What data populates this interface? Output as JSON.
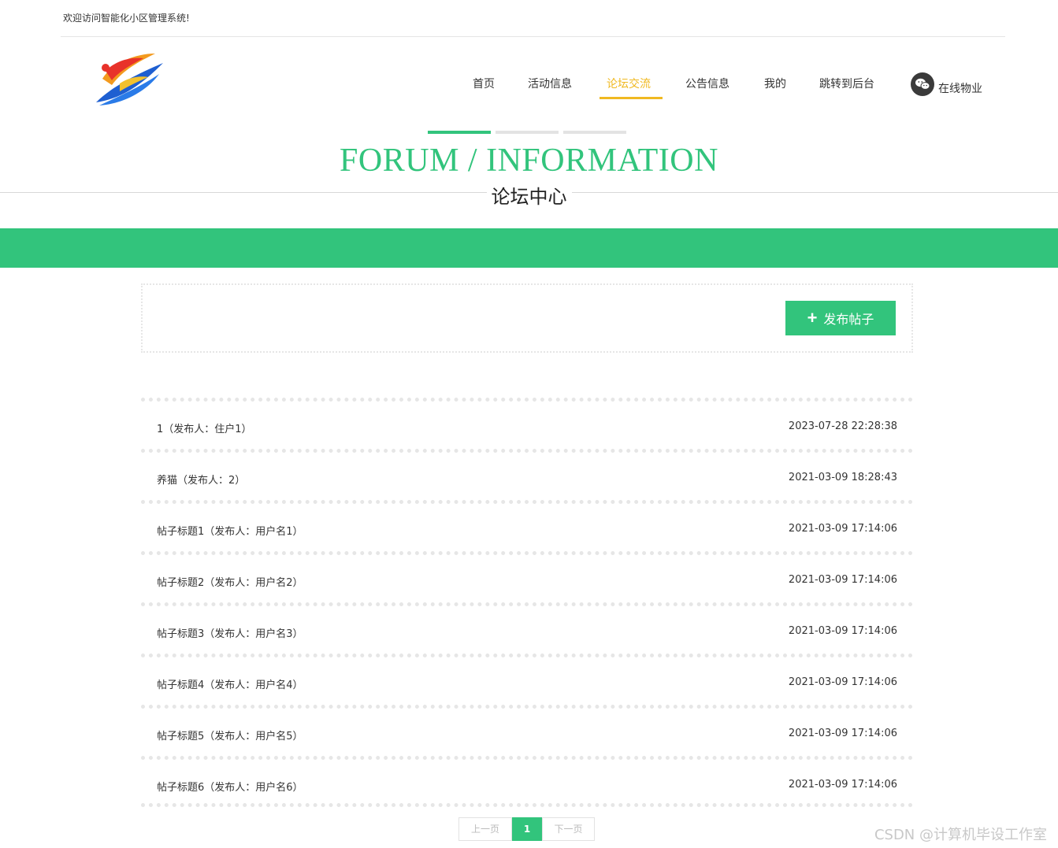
{
  "header": {
    "welcome": "欢迎访问智能化小区管理系统!"
  },
  "nav": {
    "items": [
      {
        "label": "首页",
        "active": false
      },
      {
        "label": "活动信息",
        "active": false
      },
      {
        "label": "论坛交流",
        "active": true
      },
      {
        "label": "公告信息",
        "active": false
      },
      {
        "label": "我的",
        "active": false
      },
      {
        "label": "跳转到后台",
        "active": false
      }
    ],
    "wechat_icon": "wechat-icon",
    "online_label": "在线物业"
  },
  "section": {
    "title_en": "FORUM / INFORMATION",
    "title_cn": "论坛中心"
  },
  "toolbar": {
    "publish_label": "发布帖子",
    "publish_icon": "plus-icon"
  },
  "posts": [
    {
      "title": "1（发布人：住户1）",
      "time": "2023-07-28 22:28:38"
    },
    {
      "title": "养猫（发布人：2）",
      "time": "2021-03-09 18:28:43"
    },
    {
      "title": "帖子标题1（发布人：用户名1）",
      "time": "2021-03-09 17:14:06"
    },
    {
      "title": "帖子标题2（发布人：用户名2）",
      "time": "2021-03-09 17:14:06"
    },
    {
      "title": "帖子标题3（发布人：用户名3）",
      "time": "2021-03-09 17:14:06"
    },
    {
      "title": "帖子标题4（发布人：用户名4）",
      "time": "2021-03-09 17:14:06"
    },
    {
      "title": "帖子标题5（发布人：用户名5）",
      "time": "2021-03-09 17:14:06"
    },
    {
      "title": "帖子标题6（发布人：用户名6）",
      "time": "2021-03-09 17:14:06"
    }
  ],
  "pagination": {
    "prev": "上一页",
    "current": "1",
    "next": "下一页"
  },
  "watermark": "CSDN @计算机毕设工作室",
  "colors": {
    "accent_green": "#32c47c",
    "active_nav": "#f0b921"
  }
}
